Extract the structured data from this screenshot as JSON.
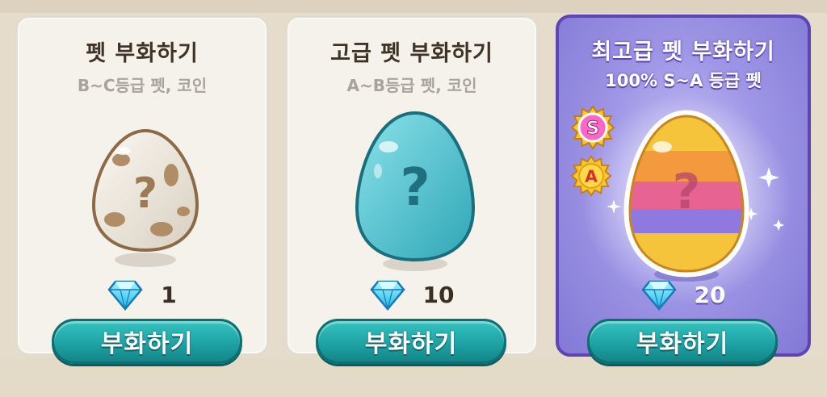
{
  "cards": [
    {
      "title": "펫 부화하기",
      "subtitle": "B~C등급 펫, 코인",
      "price": "1",
      "button_label": "부화하기",
      "egg": "spotted-white-mystery-egg"
    },
    {
      "title": "고급 펫 부화하기",
      "subtitle": "A~B등급 펫, 코인",
      "price": "10",
      "button_label": "부화하기",
      "egg": "teal-mystery-egg"
    },
    {
      "title": "최고급 펫 부화하기",
      "subtitle": "100% S~A 등급 펫",
      "price": "20",
      "button_label": "부화하기",
      "egg": "rainbow-mystery-egg",
      "badges": [
        "S",
        "A"
      ]
    }
  ],
  "currency_icon": "diamond-gem-icon",
  "colors": {
    "button": "#1fa3a5",
    "premium_bg": "#9f96e6",
    "premium_border": "#5e45b5",
    "plain_bg": "#f5f2ec"
  }
}
